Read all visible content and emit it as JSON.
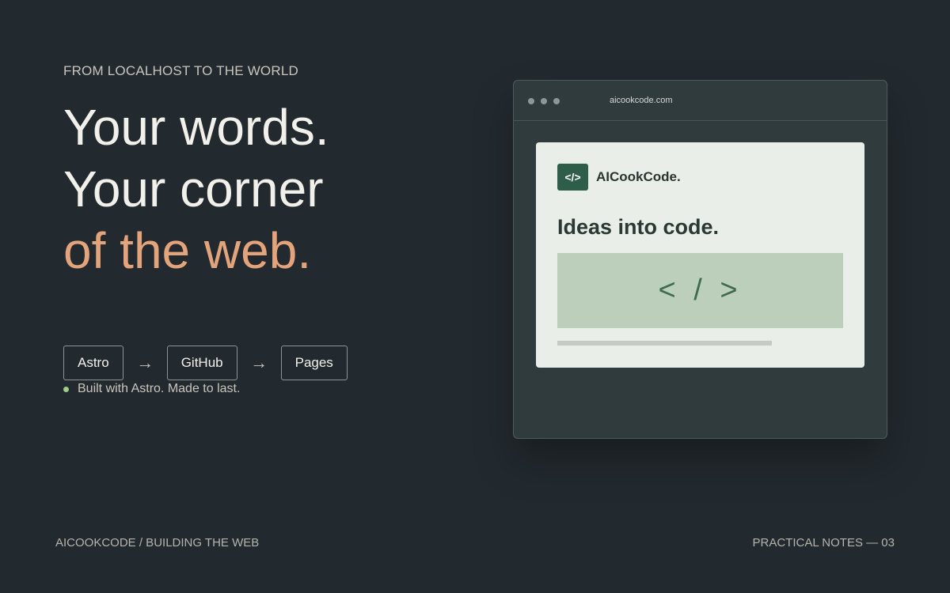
{
  "eyebrow": "FROM LOCALHOST TO THE WORLD",
  "headline": {
    "line1": "Your words.",
    "line2": "Your corner",
    "line3": "of the web."
  },
  "pipeline": {
    "steps": [
      "Astro",
      "GitHub",
      "Pages"
    ],
    "arrow": "→"
  },
  "note": "Built with Astro. Made to last.",
  "browser": {
    "url": "aicookcode.com",
    "logo_glyph": "</>",
    "brand": "AICookCode.",
    "tagline": "Ideas into code.",
    "code_glyph": "< / >"
  },
  "footer": {
    "left": "AICOOKCODE / BUILDING THE WEB",
    "right": "PRACTICAL NOTES — 03"
  },
  "colors": {
    "background": "#232a2f",
    "accent": "#e3a47c",
    "brand_green": "#2e5e4a",
    "status_dot": "#9ecf88"
  },
  "icons": {
    "status": "green-dot-icon",
    "arrow": "arrow-right-icon",
    "logo": "code-brackets-icon"
  }
}
